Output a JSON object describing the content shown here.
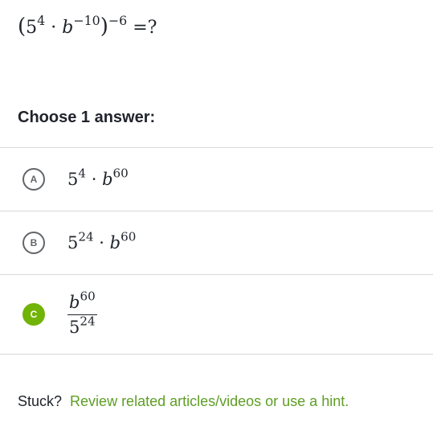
{
  "question": {
    "open_paren": "(",
    "base1": "5",
    "exp1": "4",
    "dot": "·",
    "var": "b",
    "exp2": "−10",
    "close_paren": ")",
    "outer_exp": "−6",
    "equals": "=?"
  },
  "prompt": "Choose 1 answer:",
  "choices": [
    {
      "letter": "A",
      "base1": "5",
      "exp1": "4",
      "dot": "·",
      "var": "b",
      "exp2": "60",
      "selected": false
    },
    {
      "letter": "B",
      "base1": "5",
      "exp1": "24",
      "dot": "·",
      "var": "b",
      "exp2": "60",
      "selected": false
    },
    {
      "letter": "C",
      "num_var": "b",
      "num_exp": "60",
      "den_base": "5",
      "den_exp": "24",
      "selected": true
    }
  ],
  "footer": {
    "stuck_label": "Stuck?",
    "help_link": "Review related articles/videos or use a hint."
  },
  "colors": {
    "selected_green": "#71b307",
    "link_green": "#5e9e24",
    "divider": "#d6d8da",
    "text": "#21242c"
  }
}
